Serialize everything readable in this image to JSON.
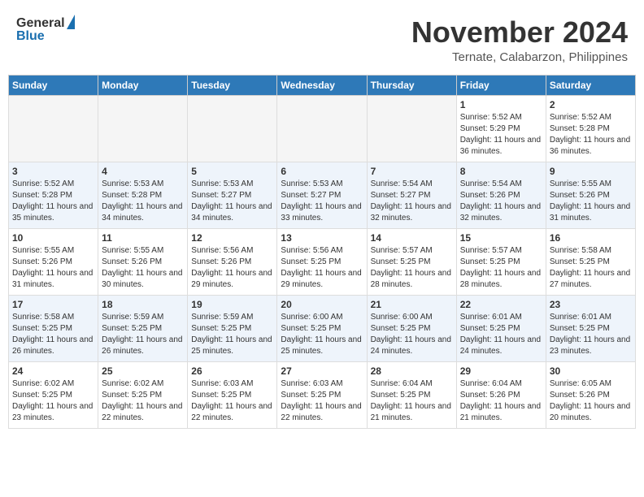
{
  "header": {
    "logo_general": "General",
    "logo_blue": "Blue",
    "month_title": "November 2024",
    "location": "Ternate, Calabarzon, Philippines"
  },
  "days_of_week": [
    "Sunday",
    "Monday",
    "Tuesday",
    "Wednesday",
    "Thursday",
    "Friday",
    "Saturday"
  ],
  "weeks": [
    [
      {
        "day": "",
        "empty": true
      },
      {
        "day": "",
        "empty": true
      },
      {
        "day": "",
        "empty": true
      },
      {
        "day": "",
        "empty": true
      },
      {
        "day": "",
        "empty": true
      },
      {
        "day": "1",
        "sunrise": "Sunrise: 5:52 AM",
        "sunset": "Sunset: 5:29 PM",
        "daylight": "Daylight: 11 hours and 36 minutes."
      },
      {
        "day": "2",
        "sunrise": "Sunrise: 5:52 AM",
        "sunset": "Sunset: 5:28 PM",
        "daylight": "Daylight: 11 hours and 36 minutes."
      }
    ],
    [
      {
        "day": "3",
        "sunrise": "Sunrise: 5:52 AM",
        "sunset": "Sunset: 5:28 PM",
        "daylight": "Daylight: 11 hours and 35 minutes."
      },
      {
        "day": "4",
        "sunrise": "Sunrise: 5:53 AM",
        "sunset": "Sunset: 5:28 PM",
        "daylight": "Daylight: 11 hours and 34 minutes."
      },
      {
        "day": "5",
        "sunrise": "Sunrise: 5:53 AM",
        "sunset": "Sunset: 5:27 PM",
        "daylight": "Daylight: 11 hours and 34 minutes."
      },
      {
        "day": "6",
        "sunrise": "Sunrise: 5:53 AM",
        "sunset": "Sunset: 5:27 PM",
        "daylight": "Daylight: 11 hours and 33 minutes."
      },
      {
        "day": "7",
        "sunrise": "Sunrise: 5:54 AM",
        "sunset": "Sunset: 5:27 PM",
        "daylight": "Daylight: 11 hours and 32 minutes."
      },
      {
        "day": "8",
        "sunrise": "Sunrise: 5:54 AM",
        "sunset": "Sunset: 5:26 PM",
        "daylight": "Daylight: 11 hours and 32 minutes."
      },
      {
        "day": "9",
        "sunrise": "Sunrise: 5:55 AM",
        "sunset": "Sunset: 5:26 PM",
        "daylight": "Daylight: 11 hours and 31 minutes."
      }
    ],
    [
      {
        "day": "10",
        "sunrise": "Sunrise: 5:55 AM",
        "sunset": "Sunset: 5:26 PM",
        "daylight": "Daylight: 11 hours and 31 minutes."
      },
      {
        "day": "11",
        "sunrise": "Sunrise: 5:55 AM",
        "sunset": "Sunset: 5:26 PM",
        "daylight": "Daylight: 11 hours and 30 minutes."
      },
      {
        "day": "12",
        "sunrise": "Sunrise: 5:56 AM",
        "sunset": "Sunset: 5:26 PM",
        "daylight": "Daylight: 11 hours and 29 minutes."
      },
      {
        "day": "13",
        "sunrise": "Sunrise: 5:56 AM",
        "sunset": "Sunset: 5:25 PM",
        "daylight": "Daylight: 11 hours and 29 minutes."
      },
      {
        "day": "14",
        "sunrise": "Sunrise: 5:57 AM",
        "sunset": "Sunset: 5:25 PM",
        "daylight": "Daylight: 11 hours and 28 minutes."
      },
      {
        "day": "15",
        "sunrise": "Sunrise: 5:57 AM",
        "sunset": "Sunset: 5:25 PM",
        "daylight": "Daylight: 11 hours and 28 minutes."
      },
      {
        "day": "16",
        "sunrise": "Sunrise: 5:58 AM",
        "sunset": "Sunset: 5:25 PM",
        "daylight": "Daylight: 11 hours and 27 minutes."
      }
    ],
    [
      {
        "day": "17",
        "sunrise": "Sunrise: 5:58 AM",
        "sunset": "Sunset: 5:25 PM",
        "daylight": "Daylight: 11 hours and 26 minutes."
      },
      {
        "day": "18",
        "sunrise": "Sunrise: 5:59 AM",
        "sunset": "Sunset: 5:25 PM",
        "daylight": "Daylight: 11 hours and 26 minutes."
      },
      {
        "day": "19",
        "sunrise": "Sunrise: 5:59 AM",
        "sunset": "Sunset: 5:25 PM",
        "daylight": "Daylight: 11 hours and 25 minutes."
      },
      {
        "day": "20",
        "sunrise": "Sunrise: 6:00 AM",
        "sunset": "Sunset: 5:25 PM",
        "daylight": "Daylight: 11 hours and 25 minutes."
      },
      {
        "day": "21",
        "sunrise": "Sunrise: 6:00 AM",
        "sunset": "Sunset: 5:25 PM",
        "daylight": "Daylight: 11 hours and 24 minutes."
      },
      {
        "day": "22",
        "sunrise": "Sunrise: 6:01 AM",
        "sunset": "Sunset: 5:25 PM",
        "daylight": "Daylight: 11 hours and 24 minutes."
      },
      {
        "day": "23",
        "sunrise": "Sunrise: 6:01 AM",
        "sunset": "Sunset: 5:25 PM",
        "daylight": "Daylight: 11 hours and 23 minutes."
      }
    ],
    [
      {
        "day": "24",
        "sunrise": "Sunrise: 6:02 AM",
        "sunset": "Sunset: 5:25 PM",
        "daylight": "Daylight: 11 hours and 23 minutes."
      },
      {
        "day": "25",
        "sunrise": "Sunrise: 6:02 AM",
        "sunset": "Sunset: 5:25 PM",
        "daylight": "Daylight: 11 hours and 22 minutes."
      },
      {
        "day": "26",
        "sunrise": "Sunrise: 6:03 AM",
        "sunset": "Sunset: 5:25 PM",
        "daylight": "Daylight: 11 hours and 22 minutes."
      },
      {
        "day": "27",
        "sunrise": "Sunrise: 6:03 AM",
        "sunset": "Sunset: 5:25 PM",
        "daylight": "Daylight: 11 hours and 22 minutes."
      },
      {
        "day": "28",
        "sunrise": "Sunrise: 6:04 AM",
        "sunset": "Sunset: 5:25 PM",
        "daylight": "Daylight: 11 hours and 21 minutes."
      },
      {
        "day": "29",
        "sunrise": "Sunrise: 6:04 AM",
        "sunset": "Sunset: 5:26 PM",
        "daylight": "Daylight: 11 hours and 21 minutes."
      },
      {
        "day": "30",
        "sunrise": "Sunrise: 6:05 AM",
        "sunset": "Sunset: 5:26 PM",
        "daylight": "Daylight: 11 hours and 20 minutes."
      }
    ]
  ]
}
